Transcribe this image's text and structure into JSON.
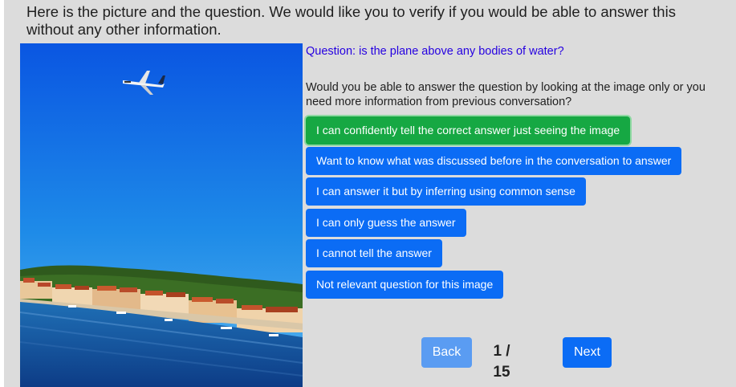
{
  "intro": "Here is the picture and the question. We would like you to verify if you would be able to answer this without any other information.",
  "question": "Question: is the plane above any bodies of water?",
  "prompt": "Would you be able to answer the question by looking at the image only or you need more information from previous conversation?",
  "answers": [
    {
      "label": "I can confidently tell the correct answer just seeing the image",
      "selected": true
    },
    {
      "label": "Want to know what was discussed before in the conversation to answer",
      "selected": false
    },
    {
      "label": "I can answer it but by inferring using common sense",
      "selected": false
    },
    {
      "label": "I can only guess the answer",
      "selected": false
    },
    {
      "label": "I cannot tell the answer",
      "selected": false
    },
    {
      "label": "Not relevant question for this image",
      "selected": false
    }
  ],
  "nav": {
    "back_label": "Back",
    "next_label": "Next",
    "page_counter": "1 / 15"
  },
  "colors": {
    "primary": "#0b6cf5",
    "selected": "#16a843",
    "question_text": "#2500e0",
    "background": "#dcdcdc"
  }
}
